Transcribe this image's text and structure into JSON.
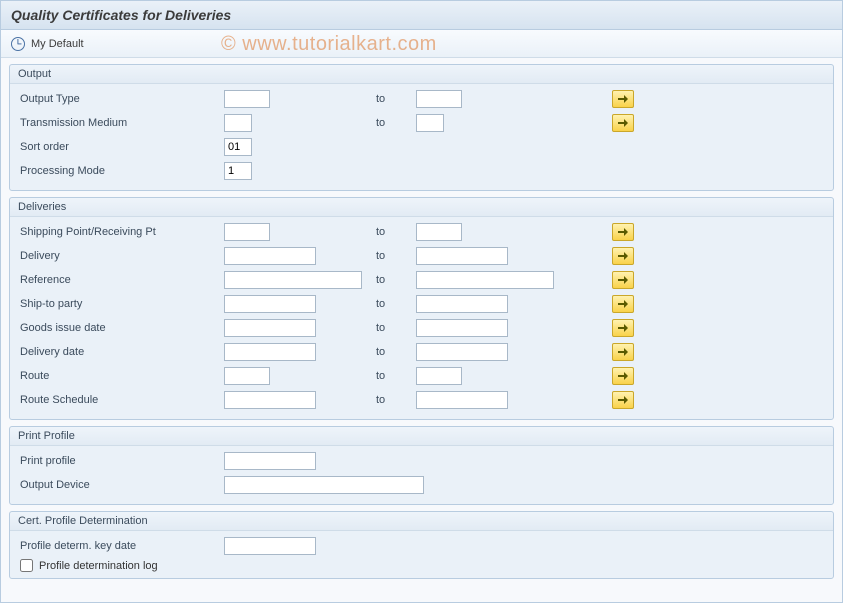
{
  "title": "Quality Certificates for Deliveries",
  "watermark": "© www.tutorialkart.com",
  "toolbar": {
    "my_default_label": "My Default"
  },
  "common": {
    "to_label": "to"
  },
  "groups": {
    "output": {
      "title": "Output",
      "output_type_label": "Output Type",
      "output_type_from": "",
      "output_type_to": "",
      "transmission_label": "Transmission Medium",
      "transmission_from": "",
      "transmission_to": "",
      "sort_order_label": "Sort order",
      "sort_order_value": "01",
      "processing_mode_label": "Processing Mode",
      "processing_mode_value": "1"
    },
    "deliveries": {
      "title": "Deliveries",
      "shipping_point_label": "Shipping Point/Receiving Pt",
      "shipping_point_from": "",
      "shipping_point_to": "",
      "delivery_label": "Delivery",
      "delivery_from": "",
      "delivery_to": "",
      "reference_label": "Reference",
      "reference_from": "",
      "reference_to": "",
      "shipto_label": "Ship-to party",
      "shipto_from": "",
      "shipto_to": "",
      "gi_date_label": "Goods issue date",
      "gi_date_from": "",
      "gi_date_to": "",
      "del_date_label": "Delivery date",
      "del_date_from": "",
      "del_date_to": "",
      "route_label": "Route",
      "route_from": "",
      "route_to": "",
      "route_sched_label": "Route Schedule",
      "route_sched_from": "",
      "route_sched_to": ""
    },
    "print_profile": {
      "title": "Print Profile",
      "print_profile_label": "Print profile",
      "print_profile_value": "",
      "output_device_label": "Output Device",
      "output_device_value": ""
    },
    "cert_profile": {
      "title": "Cert. Profile Determination",
      "key_date_label": "Profile determ. key date",
      "key_date_value": "",
      "log_label": "Profile determination log",
      "log_checked": false
    }
  }
}
